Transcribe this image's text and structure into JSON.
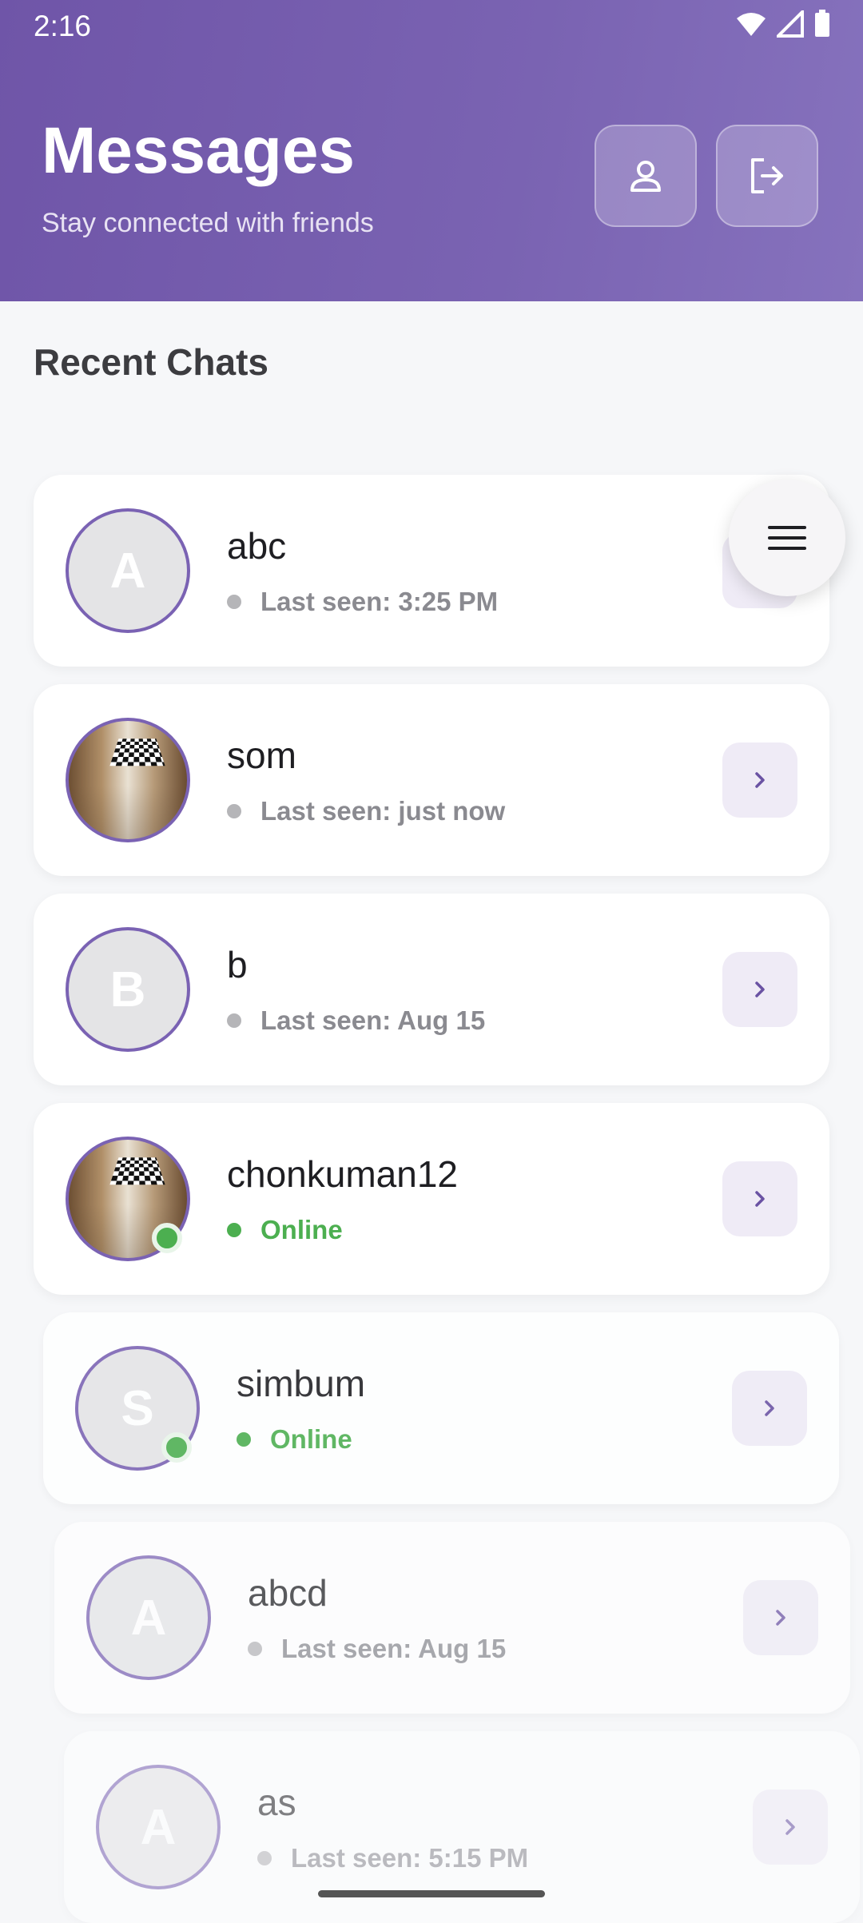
{
  "status_bar": {
    "time": "2:16"
  },
  "header": {
    "title": "Messages",
    "subtitle": "Stay connected with friends",
    "buttons": [
      {
        "icon": "person-icon"
      },
      {
        "icon": "logout-icon"
      }
    ]
  },
  "section_title": "Recent Chats",
  "chats": [
    {
      "name": "abc",
      "initial": "A",
      "status": "Last seen: 3:25 PM",
      "online": false,
      "photo": false
    },
    {
      "name": "som",
      "initial": "",
      "status": "Last seen: just now",
      "online": false,
      "photo": true
    },
    {
      "name": "b",
      "initial": "B",
      "status": "Last seen: Aug 15",
      "online": false,
      "photo": false
    },
    {
      "name": "chonkuman12",
      "initial": "",
      "status": "Online",
      "online": true,
      "photo": true
    },
    {
      "name": "simbum",
      "initial": "S",
      "status": "Online",
      "online": true,
      "photo": false
    },
    {
      "name": "abcd",
      "initial": "A",
      "status": "Last seen: Aug 15",
      "online": false,
      "photo": false
    },
    {
      "name": "as",
      "initial": "A",
      "status": "Last seen: 5:15 PM",
      "online": false,
      "photo": false
    }
  ],
  "colors": {
    "accent": "#7a62b3",
    "online": "#4caf50",
    "header": "#7a63b2"
  }
}
